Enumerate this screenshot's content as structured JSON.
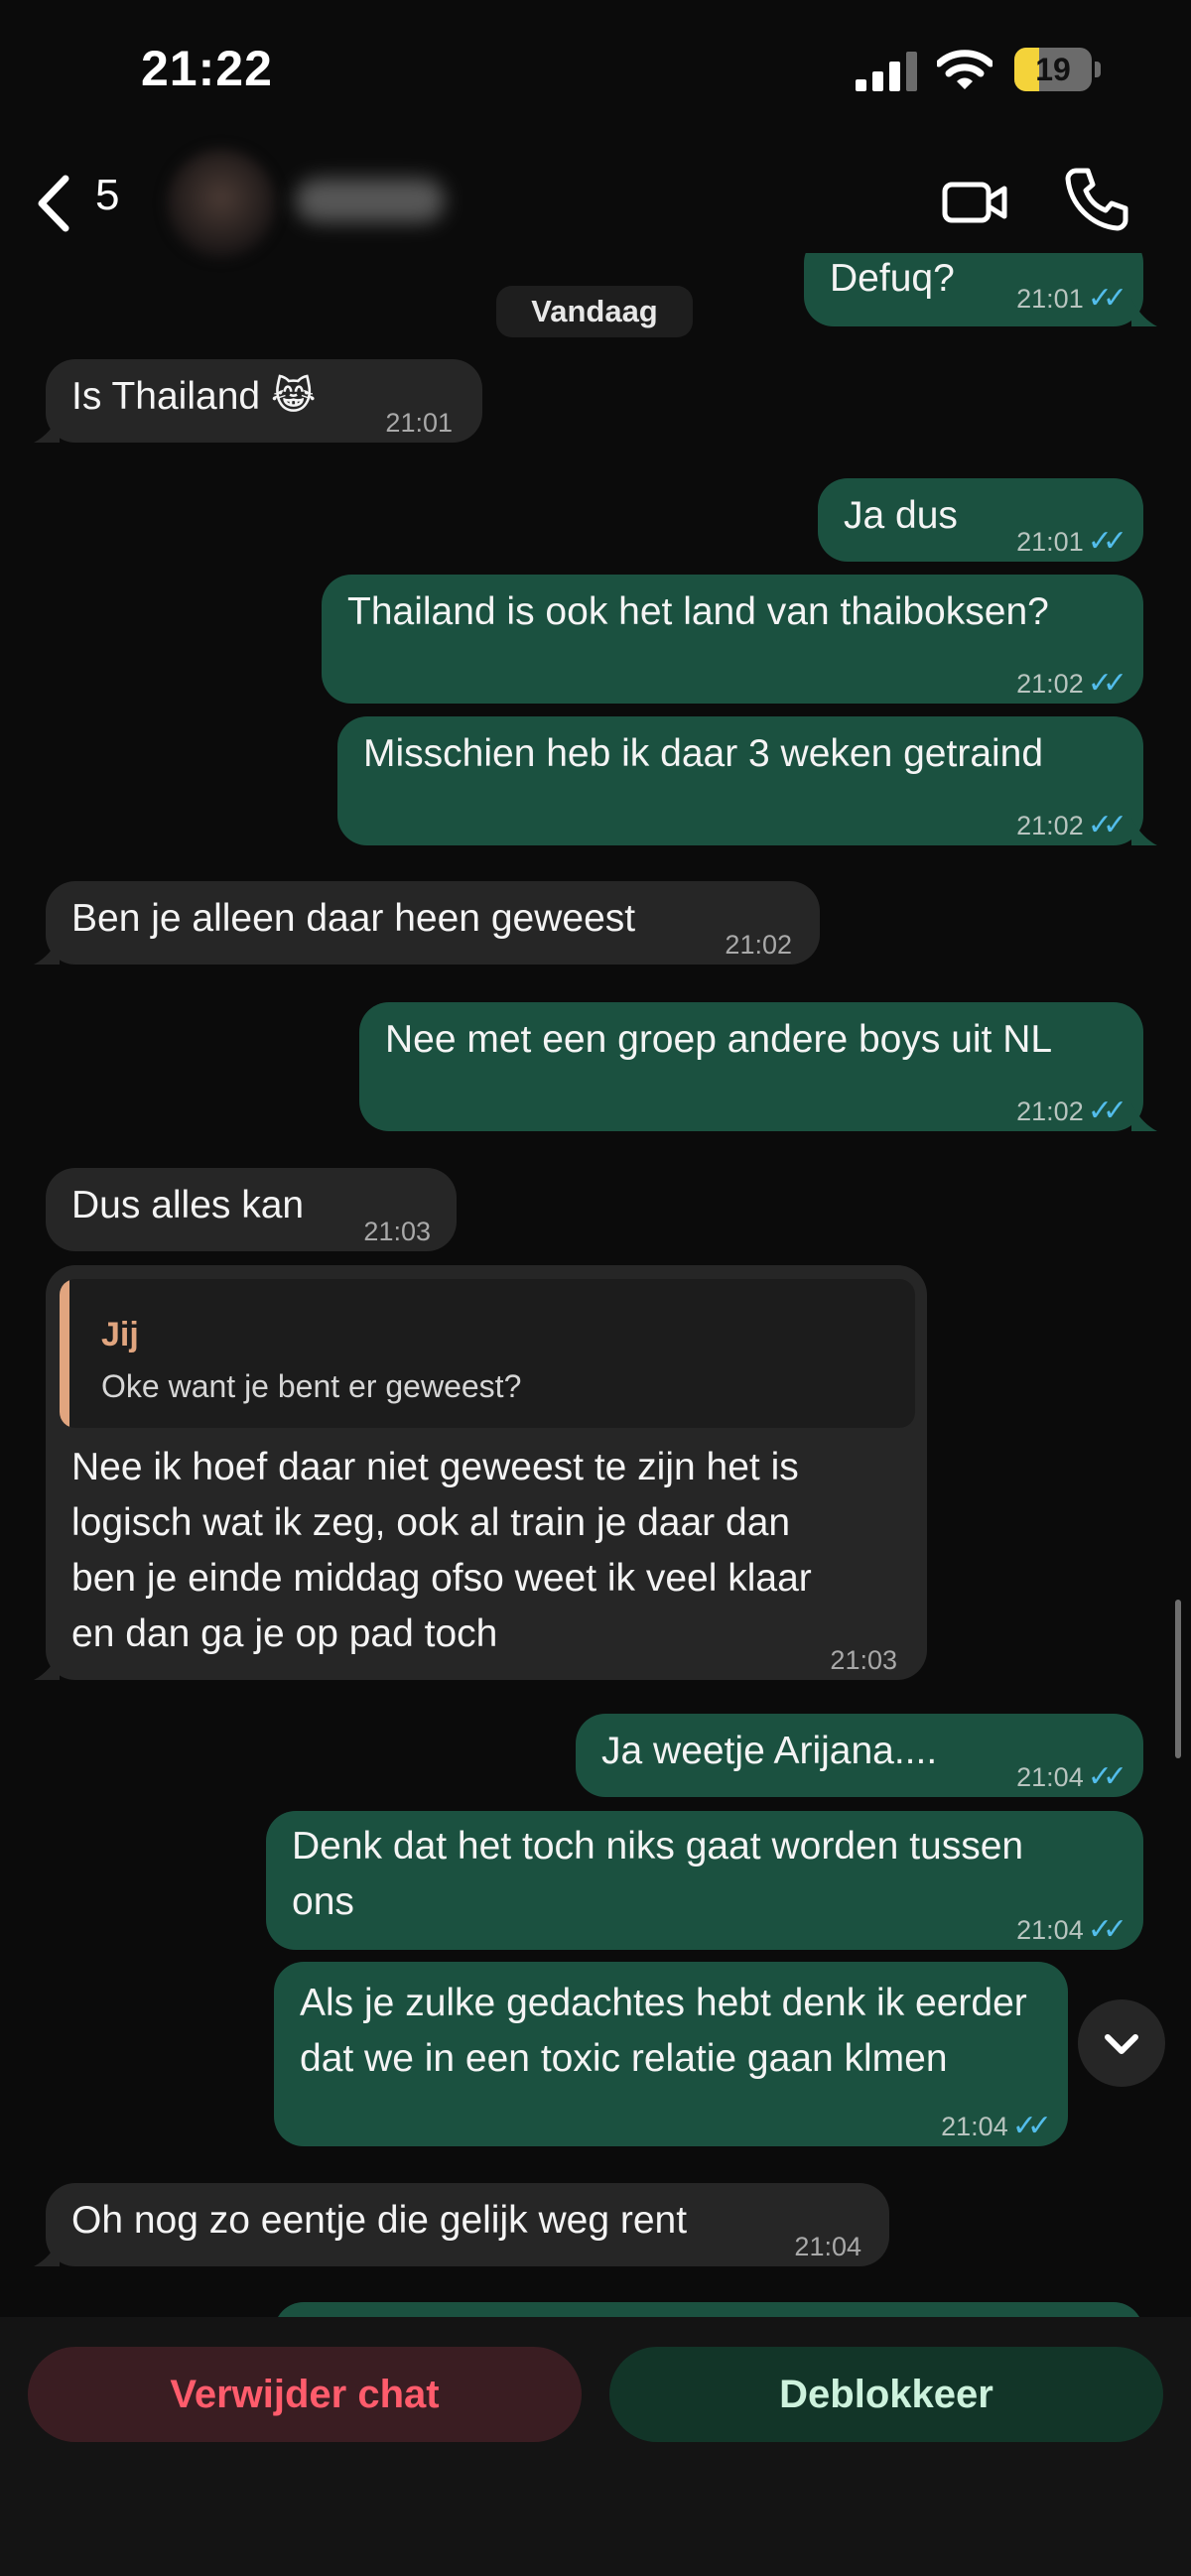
{
  "status_bar": {
    "time": "21:22",
    "battery": "19",
    "battery_level_percent": 19,
    "icons": [
      "signal-icon",
      "wifi-icon",
      "battery-icon"
    ]
  },
  "header": {
    "back_count": "5",
    "icons": [
      "back-chevron-icon",
      "video-call-icon",
      "phone-icon"
    ]
  },
  "chat": {
    "date_label": "Vandaag",
    "messages": [
      {
        "dir": "out",
        "text": "Defuq?",
        "time": "21:01",
        "read": true
      },
      {
        "dir": "in",
        "text": "Is Thailand 😹",
        "time": "21:01"
      },
      {
        "dir": "out",
        "text": "Ja dus",
        "time": "21:01",
        "read": true
      },
      {
        "dir": "out",
        "text": "Thailand is ook het land van thaiboksen?",
        "time": "21:02",
        "read": true
      },
      {
        "dir": "out",
        "text": "Misschien heb ik daar 3 weken getraind",
        "time": "21:02",
        "read": true
      },
      {
        "dir": "in",
        "text": "Ben je alleen daar heen geweest",
        "time": "21:02"
      },
      {
        "dir": "out",
        "text": "Nee met een groep andere boys uit NL",
        "time": "21:02",
        "read": true
      },
      {
        "dir": "in",
        "text": "Dus alles kan",
        "time": "21:03"
      },
      {
        "dir": "in",
        "reply_to": {
          "author": "Jij",
          "text": "Oke want je bent er geweest?"
        },
        "lines": [
          "Nee ik hoef daar niet geweest te zijn het is",
          "logisch wat ik zeg, ook al train je daar dan",
          "ben je einde middag ofso weet ik veel klaar",
          "en dan ga je op pad toch"
        ],
        "time": "21:03"
      },
      {
        "dir": "out",
        "text": "Ja weetje Arijana....",
        "time": "21:04",
        "read": true
      },
      {
        "dir": "out",
        "lines": [
          "Denk dat het toch niks gaat worden tussen",
          "ons"
        ],
        "time": "21:04",
        "read": true
      },
      {
        "dir": "out",
        "lines": [
          "Als je zulke gedachtes hebt denk ik eerder",
          "dat we in een toxic relatie gaan klmen"
        ],
        "time": "21:04",
        "read": true
      },
      {
        "dir": "in",
        "text": "Oh nog zo eentje die gelijk weg rent",
        "time": "21:04"
      }
    ]
  },
  "bottom_bar": {
    "delete_label": "Verwijder chat",
    "unblock_label": "Deblokkeer"
  },
  "colors": {
    "background": "#0b0b0b",
    "incoming_bubble": "#262626",
    "outgoing_bubble": "#1b5140",
    "read_ticks": "#53bdeb",
    "delete_text": "#ff5c6c",
    "quote_accent": "#e1a57f"
  }
}
